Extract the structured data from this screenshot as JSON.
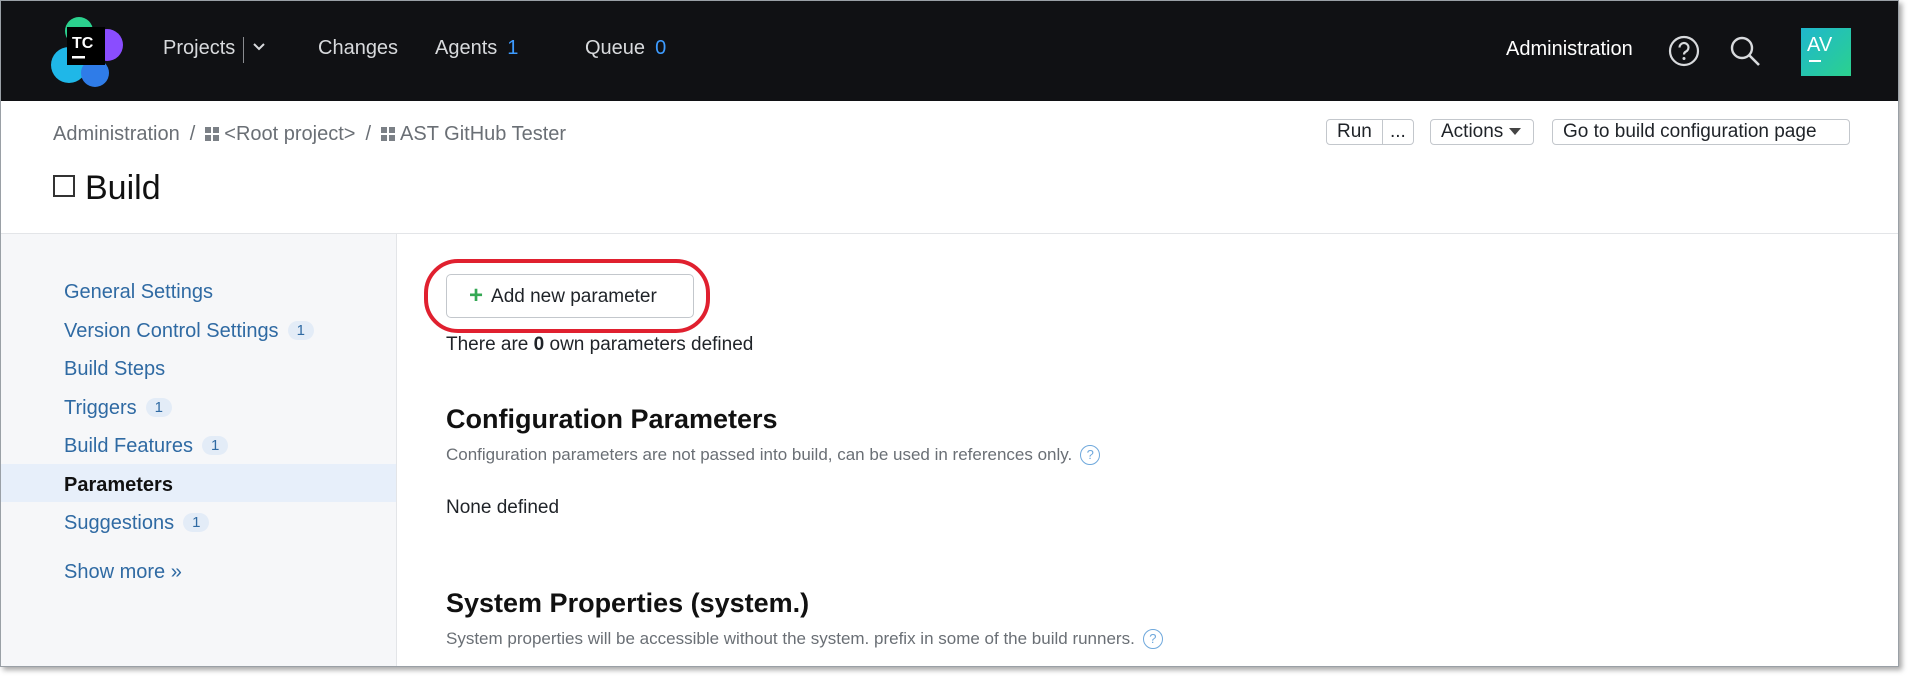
{
  "header": {
    "logo_text": "TC",
    "nav": [
      {
        "label": "Projects"
      },
      {
        "label": "Changes"
      },
      {
        "label": "Agents",
        "count": "1"
      },
      {
        "label": "Queue",
        "count": "0"
      }
    ],
    "admin_label": "Administration",
    "avatar_initials": "AV"
  },
  "breadcrumb": {
    "items": [
      "Administration",
      "<Root project>",
      "AST GitHub Tester"
    ],
    "separator": "/"
  },
  "toolbar": {
    "run_label": "Run",
    "run_more_label": "...",
    "actions_label": "Actions",
    "goto_label": "Go to build configuration page"
  },
  "page": {
    "title": "Build"
  },
  "sidebar": {
    "items": [
      {
        "label": "General Settings",
        "badge": ""
      },
      {
        "label": "Version Control Settings",
        "badge": "1"
      },
      {
        "label": "Build Steps",
        "badge": ""
      },
      {
        "label": "Triggers",
        "badge": "1"
      },
      {
        "label": "Build Features",
        "badge": "1"
      },
      {
        "label": "Parameters",
        "badge": "",
        "active": true
      },
      {
        "label": "Suggestions",
        "badge": "1"
      }
    ],
    "show_more_label": "Show more »"
  },
  "main": {
    "add_button_label": "Add new parameter",
    "own_params_prefix": "There are ",
    "own_params_count": "0",
    "own_params_suffix": " own parameters defined",
    "config_section": {
      "title": "Configuration Parameters",
      "subtitle": "Configuration parameters are not passed into build, can be used in references only.",
      "empty_text": "None defined"
    },
    "system_section": {
      "title": "System Properties (system.)",
      "subtitle": "System properties will be accessible without the system. prefix in some of the build runners."
    }
  },
  "colors": {
    "header_bg": "#101114",
    "link": "#2f6aa3",
    "count_accent": "#3d9bff",
    "highlight_ring": "#e0202f",
    "plus_green": "#34a853"
  }
}
